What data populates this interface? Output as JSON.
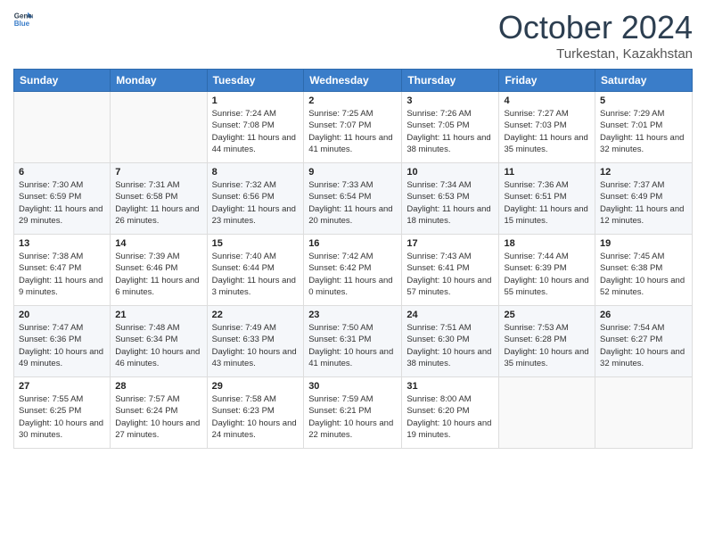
{
  "logo": {
    "line1": "General",
    "line2": "Blue"
  },
  "title": "October 2024",
  "location": "Turkestan, Kazakhstan",
  "days_of_week": [
    "Sunday",
    "Monday",
    "Tuesday",
    "Wednesday",
    "Thursday",
    "Friday",
    "Saturday"
  ],
  "weeks": [
    [
      {
        "day": "",
        "text": ""
      },
      {
        "day": "",
        "text": ""
      },
      {
        "day": "1",
        "text": "Sunrise: 7:24 AM\nSunset: 7:08 PM\nDaylight: 11 hours and 44 minutes."
      },
      {
        "day": "2",
        "text": "Sunrise: 7:25 AM\nSunset: 7:07 PM\nDaylight: 11 hours and 41 minutes."
      },
      {
        "day": "3",
        "text": "Sunrise: 7:26 AM\nSunset: 7:05 PM\nDaylight: 11 hours and 38 minutes."
      },
      {
        "day": "4",
        "text": "Sunrise: 7:27 AM\nSunset: 7:03 PM\nDaylight: 11 hours and 35 minutes."
      },
      {
        "day": "5",
        "text": "Sunrise: 7:29 AM\nSunset: 7:01 PM\nDaylight: 11 hours and 32 minutes."
      }
    ],
    [
      {
        "day": "6",
        "text": "Sunrise: 7:30 AM\nSunset: 6:59 PM\nDaylight: 11 hours and 29 minutes."
      },
      {
        "day": "7",
        "text": "Sunrise: 7:31 AM\nSunset: 6:58 PM\nDaylight: 11 hours and 26 minutes."
      },
      {
        "day": "8",
        "text": "Sunrise: 7:32 AM\nSunset: 6:56 PM\nDaylight: 11 hours and 23 minutes."
      },
      {
        "day": "9",
        "text": "Sunrise: 7:33 AM\nSunset: 6:54 PM\nDaylight: 11 hours and 20 minutes."
      },
      {
        "day": "10",
        "text": "Sunrise: 7:34 AM\nSunset: 6:53 PM\nDaylight: 11 hours and 18 minutes."
      },
      {
        "day": "11",
        "text": "Sunrise: 7:36 AM\nSunset: 6:51 PM\nDaylight: 11 hours and 15 minutes."
      },
      {
        "day": "12",
        "text": "Sunrise: 7:37 AM\nSunset: 6:49 PM\nDaylight: 11 hours and 12 minutes."
      }
    ],
    [
      {
        "day": "13",
        "text": "Sunrise: 7:38 AM\nSunset: 6:47 PM\nDaylight: 11 hours and 9 minutes."
      },
      {
        "day": "14",
        "text": "Sunrise: 7:39 AM\nSunset: 6:46 PM\nDaylight: 11 hours and 6 minutes."
      },
      {
        "day": "15",
        "text": "Sunrise: 7:40 AM\nSunset: 6:44 PM\nDaylight: 11 hours and 3 minutes."
      },
      {
        "day": "16",
        "text": "Sunrise: 7:42 AM\nSunset: 6:42 PM\nDaylight: 11 hours and 0 minutes."
      },
      {
        "day": "17",
        "text": "Sunrise: 7:43 AM\nSunset: 6:41 PM\nDaylight: 10 hours and 57 minutes."
      },
      {
        "day": "18",
        "text": "Sunrise: 7:44 AM\nSunset: 6:39 PM\nDaylight: 10 hours and 55 minutes."
      },
      {
        "day": "19",
        "text": "Sunrise: 7:45 AM\nSunset: 6:38 PM\nDaylight: 10 hours and 52 minutes."
      }
    ],
    [
      {
        "day": "20",
        "text": "Sunrise: 7:47 AM\nSunset: 6:36 PM\nDaylight: 10 hours and 49 minutes."
      },
      {
        "day": "21",
        "text": "Sunrise: 7:48 AM\nSunset: 6:34 PM\nDaylight: 10 hours and 46 minutes."
      },
      {
        "day": "22",
        "text": "Sunrise: 7:49 AM\nSunset: 6:33 PM\nDaylight: 10 hours and 43 minutes."
      },
      {
        "day": "23",
        "text": "Sunrise: 7:50 AM\nSunset: 6:31 PM\nDaylight: 10 hours and 41 minutes."
      },
      {
        "day": "24",
        "text": "Sunrise: 7:51 AM\nSunset: 6:30 PM\nDaylight: 10 hours and 38 minutes."
      },
      {
        "day": "25",
        "text": "Sunrise: 7:53 AM\nSunset: 6:28 PM\nDaylight: 10 hours and 35 minutes."
      },
      {
        "day": "26",
        "text": "Sunrise: 7:54 AM\nSunset: 6:27 PM\nDaylight: 10 hours and 32 minutes."
      }
    ],
    [
      {
        "day": "27",
        "text": "Sunrise: 7:55 AM\nSunset: 6:25 PM\nDaylight: 10 hours and 30 minutes."
      },
      {
        "day": "28",
        "text": "Sunrise: 7:57 AM\nSunset: 6:24 PM\nDaylight: 10 hours and 27 minutes."
      },
      {
        "day": "29",
        "text": "Sunrise: 7:58 AM\nSunset: 6:23 PM\nDaylight: 10 hours and 24 minutes."
      },
      {
        "day": "30",
        "text": "Sunrise: 7:59 AM\nSunset: 6:21 PM\nDaylight: 10 hours and 22 minutes."
      },
      {
        "day": "31",
        "text": "Sunrise: 8:00 AM\nSunset: 6:20 PM\nDaylight: 10 hours and 19 minutes."
      },
      {
        "day": "",
        "text": ""
      },
      {
        "day": "",
        "text": ""
      }
    ]
  ]
}
